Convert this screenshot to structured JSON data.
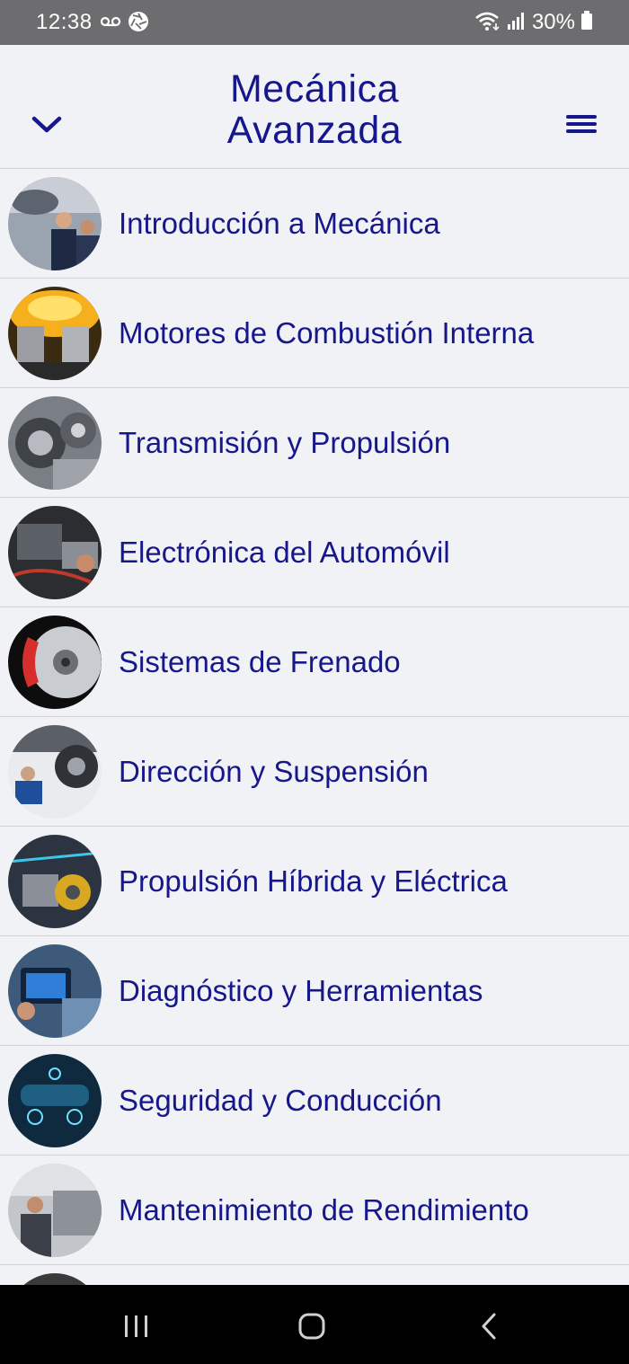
{
  "status_bar": {
    "time": "12:38",
    "battery": "30%",
    "icons": [
      "voicemail-icon",
      "aperture-icon",
      "wifi-icon",
      "signal-icon",
      "battery-icon"
    ]
  },
  "header": {
    "title_line1": "Mecánica",
    "title_line2": "Avanzada",
    "back_icon": "chevron-down-icon",
    "menu_icon": "hamburger-menu-icon",
    "accent_color": "#17178c"
  },
  "topics": [
    {
      "label": "Introducción a Mecánica",
      "thumb": "mechanics-team-photo"
    },
    {
      "label": "Motores de Combustión Interna",
      "thumb": "engine-pistons-photo"
    },
    {
      "label": "Transmisión y Propulsión",
      "thumb": "gearbox-photo"
    },
    {
      "label": "Electrónica del Automóvil",
      "thumb": "car-electronics-photo"
    },
    {
      "label": "Sistemas de Frenado",
      "thumb": "brake-disc-photo"
    },
    {
      "label": "Dirección y Suspensión",
      "thumb": "suspension-photo"
    },
    {
      "label": "Propulsión Híbrida y Eléctrica",
      "thumb": "electric-motor-photo"
    },
    {
      "label": "Diagnóstico y Herramientas",
      "thumb": "diagnostic-tablet-photo"
    },
    {
      "label": "Seguridad y Conducción",
      "thumb": "car-safety-hud-photo"
    },
    {
      "label": "Mantenimiento de Rendimiento",
      "thumb": "mechanic-service-photo"
    }
  ],
  "nav_bar": {
    "icons": [
      "recent-apps-icon",
      "home-icon",
      "back-icon"
    ]
  }
}
